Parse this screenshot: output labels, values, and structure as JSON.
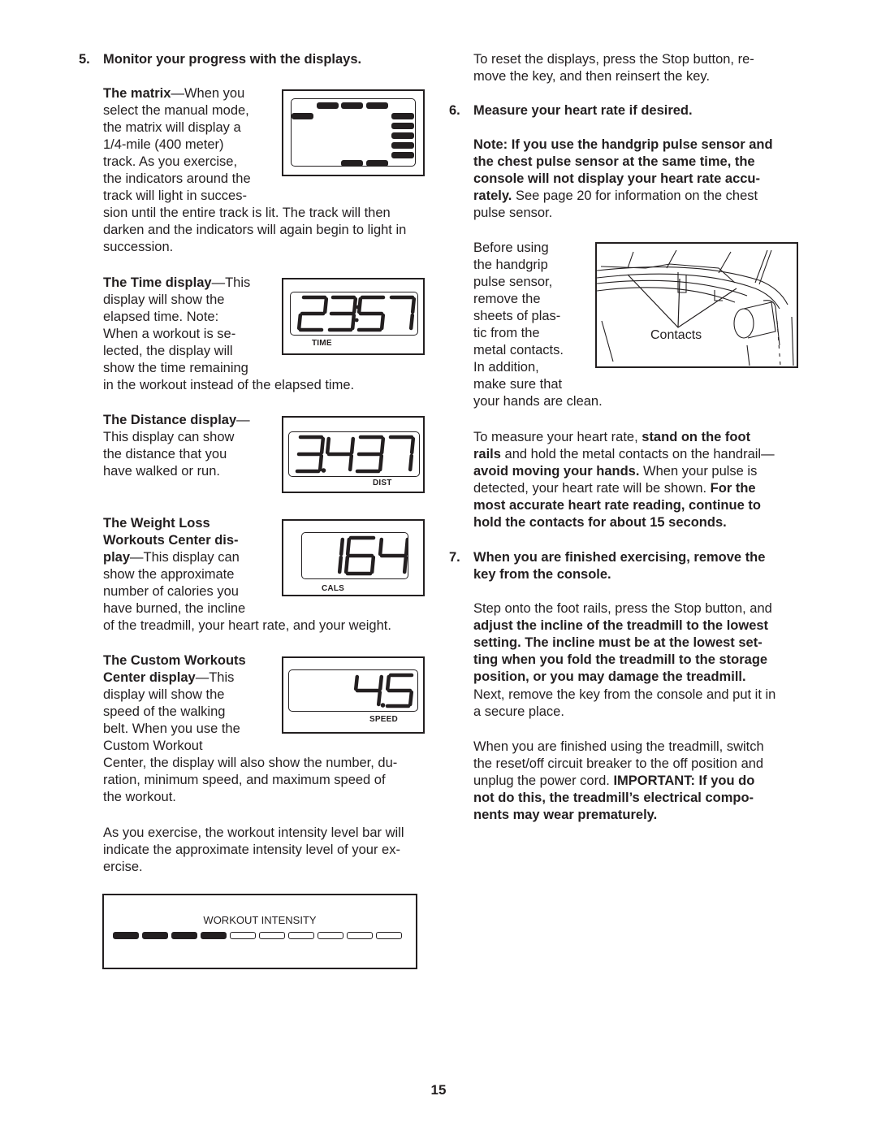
{
  "page_number": "15",
  "left_column": {
    "step5": {
      "number": "5.",
      "heading": "Monitor your progress with the displays.",
      "matrix": {
        "term": "The matrix",
        "dash": "—",
        "lines": [
          "When you",
          "select the manual mode,",
          "the matrix will display a",
          "1/4-mile (400 meter)",
          "track. As you exercise,",
          "the indicators around the",
          "track will light in succes-",
          "sion until the entire track is lit. The track will then",
          "darken and the indicators will again begin to light in",
          "succession."
        ]
      },
      "time": {
        "term": "The Time display",
        "dash": "—",
        "lines": [
          "This",
          "display will show the",
          "elapsed time. Note:",
          "When a workout is se-",
          "lected, the display will",
          "show the time remaining",
          "in the workout instead of the elapsed time."
        ],
        "display_value": "23:57",
        "display_label": "TIME"
      },
      "distance": {
        "term": "The Distance display",
        "dash": "—",
        "lines": [
          "This display can show",
          "the distance that you",
          "have walked or run."
        ],
        "display_value": "3.437",
        "display_label": "DIST"
      },
      "weight_loss": {
        "term_lines": [
          "The Weight Loss",
          "Workouts Center dis-",
          "play"
        ],
        "dash": "—",
        "lines": [
          "This display can",
          "show the approximate",
          "number of calories you",
          "have burned, the incline",
          "of the treadmill, your heart rate, and your weight."
        ],
        "display_value": "164",
        "display_label": "CALS"
      },
      "custom": {
        "term_lines": [
          "The Custom Workouts",
          "Center display"
        ],
        "dash": "—",
        "lines": [
          "This",
          "display will show the",
          "speed of the walking",
          "belt. When you use the",
          "Custom Workout",
          "Center, the display will also show the number, du-",
          "ration, minimum speed, and maximum speed of",
          "the workout."
        ],
        "display_value": "4.5",
        "display_label": "SPEED"
      },
      "intensity_text": [
        "As you exercise, the workout intensity level bar will",
        "indicate the approximate intensity level of your ex-",
        "ercise."
      ],
      "intensity_display": {
        "label": "WORKOUT INTENSITY",
        "level": 4,
        "total": 10
      }
    }
  },
  "right_column": {
    "reset_text": [
      "To reset the displays, press the Stop button, re-",
      "move the key, and then reinsert the key."
    ],
    "step6": {
      "number": "6.",
      "heading": "Measure your heart rate if desired.",
      "note_bold": [
        "Note: If you use the handgrip pulse sensor and",
        "the chest pulse sensor at the same time, the",
        "console will not display your heart rate accu-"
      ],
      "note_last_bold": "rately.",
      "note_last_regular": " See page 20 for information on the chest",
      "note_end": "pulse sensor.",
      "before_lines": [
        "Before using",
        "the handgrip",
        "pulse sensor,",
        "remove the",
        "sheets of plas-",
        "tic from the",
        "metal contacts.",
        "In addition,",
        "make sure that",
        "your hands are clean."
      ],
      "illustration_label": "Contacts",
      "measure": {
        "l1_reg": "To measure your heart rate, ",
        "l1_bold": "stand on the foot",
        "l2_bold": "rails",
        "l2_reg": " and hold the metal contacts on the handrail—",
        "l3_bold": "avoid moving your hands.",
        "l3_reg": " When your pulse is",
        "l4_reg": "detected, your heart rate will be shown. ",
        "l4_bold": "For the",
        "l5_bold": "most accurate heart rate reading, continue to",
        "l6_bold": "hold the contacts for about 15 seconds."
      }
    },
    "step7": {
      "number": "7.",
      "heading_lines": [
        "When you are finished exercising, remove the",
        "key from the console."
      ],
      "p1_l1": "Step onto the foot rails, press the Stop button, and",
      "p1_bold": [
        "adjust the incline of the treadmill to the lowest",
        "setting. The incline must be at the lowest set-",
        "ting when you fold the treadmill to the storage",
        "position, or you may damage the treadmill."
      ],
      "p1_tail": [
        "Next, remove the key from the console and put it in",
        "a secure place."
      ],
      "p2_lines": [
        "When you are finished using the treadmill, switch",
        "the reset/off circuit breaker to the off position and"
      ],
      "p2_l3_reg": "unplug the power cord. ",
      "p2_l3_bold": "IMPORTANT: If you do",
      "p2_bold": [
        "not do this, the treadmill’s electrical compo-",
        "nents may wear prematurely."
      ]
    }
  }
}
